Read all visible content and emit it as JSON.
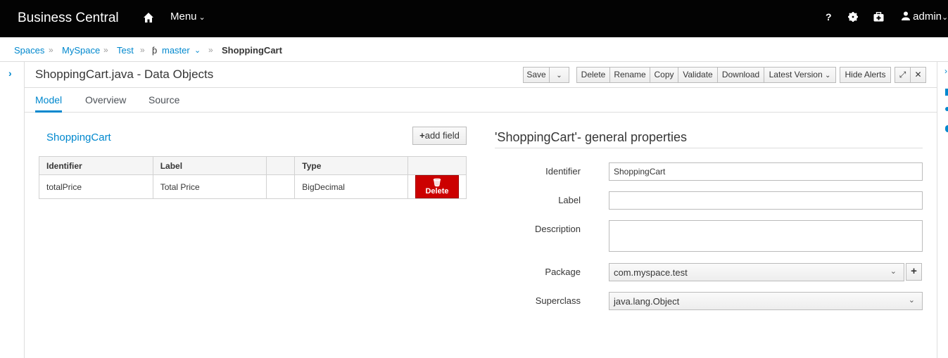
{
  "topbar": {
    "brand": "Business Central",
    "menu_label": "Menu",
    "help": "?",
    "user": "admin"
  },
  "breadcrumb": {
    "items": [
      "Spaces",
      "MySpace",
      "Test",
      "master"
    ],
    "current": "ShoppingCart"
  },
  "editor": {
    "title": "ShoppingCart.java - Data Objects",
    "toolbar": {
      "save": "Save",
      "delete": "Delete",
      "rename": "Rename",
      "copy": "Copy",
      "validate": "Validate",
      "download": "Download",
      "latest_version": "Latest Version",
      "hide_alerts": "Hide Alerts"
    },
    "tabs": [
      "Model",
      "Overview",
      "Source"
    ]
  },
  "model": {
    "object_name": "ShoppingCart",
    "add_field": "add field",
    "columns": [
      "Identifier",
      "Label",
      "",
      "Type",
      ""
    ],
    "rows": [
      {
        "identifier": "totalPrice",
        "label": "Total Price",
        "type": "BigDecimal",
        "delete": "Delete"
      }
    ]
  },
  "properties": {
    "title": "'ShoppingCart'- general properties",
    "identifier_label": "Identifier",
    "identifier_value": "ShoppingCart",
    "label_label": "Label",
    "label_value": "",
    "description_label": "Description",
    "description_value": "",
    "package_label": "Package",
    "package_value": "com.myspace.test",
    "superclass_label": "Superclass",
    "superclass_value": "java.lang.Object"
  },
  "colors": {
    "accent": "#0088ce",
    "danger": "#cc0000",
    "topbar": "#030303"
  }
}
